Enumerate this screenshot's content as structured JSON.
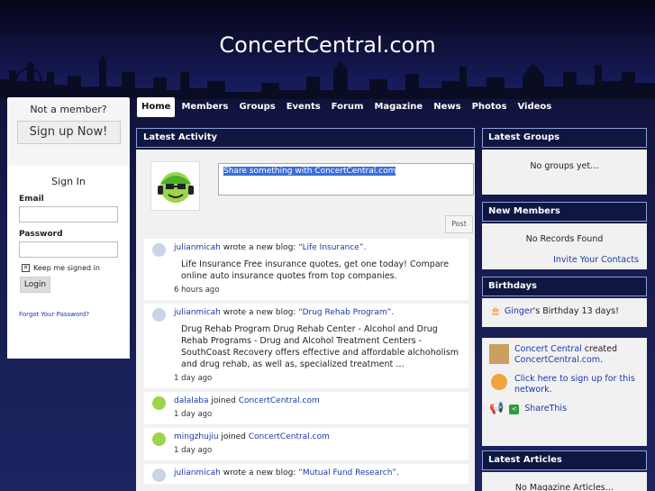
{
  "site": {
    "title": "ConcertCentral.com"
  },
  "nav": {
    "items": [
      "Home",
      "Members",
      "Groups",
      "Events",
      "Forum",
      "Magazine",
      "News",
      "Photos",
      "Videos"
    ]
  },
  "left": {
    "not_member": "Not a member?",
    "signup": "Sign up Now!",
    "signin_title": "Sign In",
    "email_label": "Email",
    "password_label": "Password",
    "keep_signed": "Keep me signed in",
    "login": "Login",
    "forgot": "Forgot Your Password?"
  },
  "center": {
    "title": "Latest Activity",
    "share_placeholder": "Share something with ConcertCentral.com",
    "post": "Post",
    "feed": [
      {
        "user": "julianmicah",
        "action": " wrote a new blog: ",
        "link": "“Life Insurance”",
        "tail": ".",
        "body": "Life Insurance Free insurance quotes, get one today! Compare online auto insurance quotes from top companies.",
        "time": "6 hours ago"
      },
      {
        "user": "julianmicah",
        "action": " wrote a new blog: ",
        "link": "“Drug Rehab Program”",
        "tail": ".",
        "body": "Drug Rehab Program Drug Rehab Center - Alcohol and Drug Rehab Programs - Drug and Alcohol Treatment Centers - SouthCoast Recovery offers effective and affordable alchoholism and drug rehab, as well as,  specialized treatment …",
        "time": "1 day ago"
      },
      {
        "user": "dalalaba",
        "action": " joined ",
        "link": "ConcertCentral.com",
        "tail": "",
        "body": "",
        "time": "1 day ago"
      },
      {
        "user": "mingzhujiu",
        "action": " joined ",
        "link": "ConcertCentral.com",
        "tail": "",
        "body": "",
        "time": "1 day ago"
      },
      {
        "user": "julianmicah",
        "action": " wrote a new blog: ",
        "link": "“Mutual Fund Research”",
        "tail": ".",
        "body": "",
        "time": ""
      }
    ]
  },
  "right": {
    "groups_title": "Latest Groups",
    "groups_empty": "No groups yet…",
    "members_title": "New Members",
    "members_empty": "No Records Found",
    "invite": "Invite Your Contacts",
    "birthdays_title": "Birthdays",
    "birthday_user": "Ginger",
    "birthday_text": "'s Birthday  13 days!",
    "cc_user": "Concert Central",
    "cc_action": " created ",
    "cc_link": "ConcertCentral.com",
    "cc_tail": ".",
    "signup_prompt": "Click here to sign up for this network.",
    "share_this": "ShareThis",
    "articles_title": "Latest Articles",
    "articles_empty": "No Magazine Articles…"
  }
}
